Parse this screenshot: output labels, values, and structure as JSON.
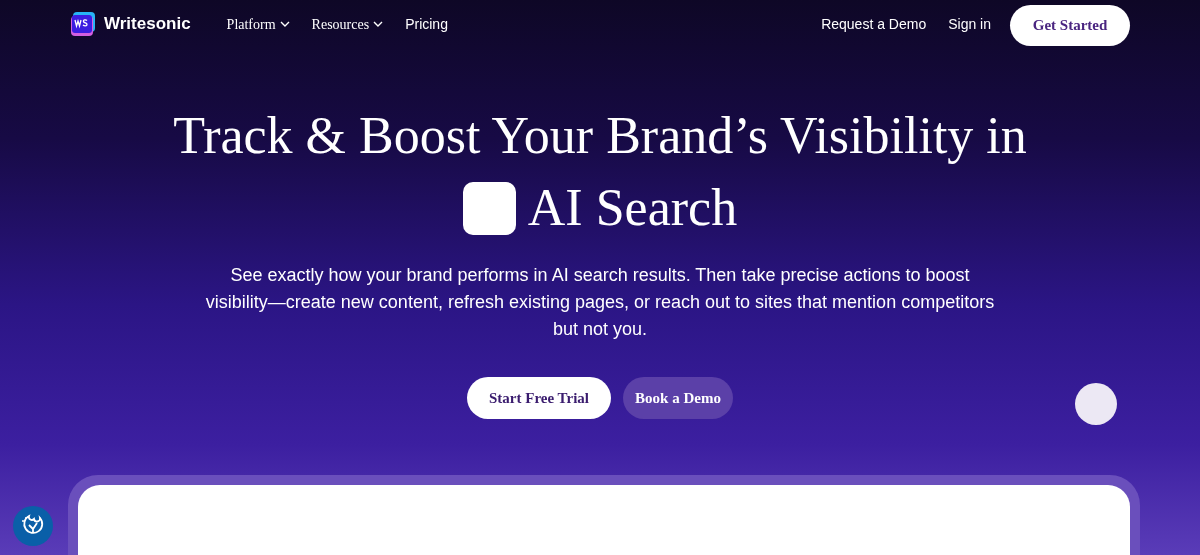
{
  "nav": {
    "brand": "Writesonic",
    "menu": [
      {
        "label": "Platform",
        "kind": "dropdown"
      },
      {
        "label": "Resources",
        "kind": "dropdown"
      },
      {
        "label": "Pricing",
        "kind": "link"
      }
    ],
    "actions": {
      "request_demo": "Request a Demo",
      "sign_in": "Sign in",
      "get_started": "Get Started"
    }
  },
  "hero": {
    "title_line_1": "Track & Boost Your Brand’s Visibility in",
    "title_line_2": "AI Search",
    "subtitle": "See exactly how your brand performs in AI search results. Then take precise actions to boost visibility—create new content, refresh existing pages, or reach out to sites that mention competitors but not you.",
    "primary_button": "Start Free Trial",
    "secondary_button": "Book a Demo"
  }
}
